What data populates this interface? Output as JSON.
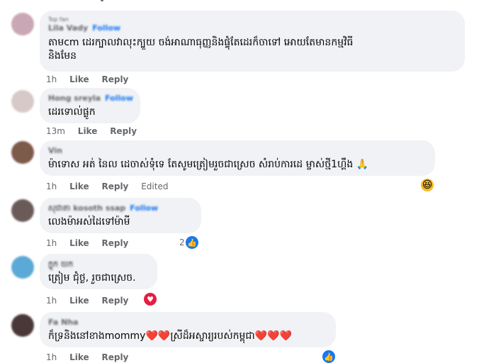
{
  "comments": [
    {
      "top_label": "Top fan",
      "author": "Lila Vady",
      "follow": "Follow",
      "text": "តាមcm ដេរក្បាលវាលុះក្បួយ ចង់អាណាធុញ្ញនិងផ្ទុំតែដេរក៏ចាទៅ អោយតែមានកម្មវិធី\nនិងមែន",
      "time": "1h",
      "like": "Like",
      "reply": "Reply",
      "avatar_color": "#c9a7b4"
    },
    {
      "author": "Hong sreyla",
      "follow": "Follow",
      "text": "ដេរទោល់ផ្លូក",
      "time": "13m",
      "like": "Like",
      "reply": "Reply",
      "avatar_color": "#d8c9c9"
    },
    {
      "author": "Vin",
      "text": "ម៉ាទោស អត់ នៃល ដេចាស់ទុំទេ តែសូមត្រៀមរួចជាស្រេច សំរាប់ការដេ ម្ចាស់ថ្មី1ហ្គឹង 🙏",
      "time": "1h",
      "like": "Like",
      "reply": "Reply",
      "edited": "Edited",
      "reaction": "😆",
      "avatar_color": "#7d5a4a"
    },
    {
      "author": "សុជាតា kosoth ssap",
      "follow": "Follow",
      "text": "លេងម៉ាអស់ដៃទៅម៉ាមី",
      "time": "1h",
      "like": "Like",
      "reply": "Reply",
      "reaction_count": "2",
      "reaction": "👍",
      "avatar_color": "#6b5b58"
    },
    {
      "author": "ក្លូក យក",
      "text": "ត្រៀម ជុំថ្ង, រួចជាស្រេច.",
      "time": "1h",
      "like": "Like",
      "reply": "Reply",
      "reaction": "♥",
      "avatar_color": "#5aa9d6"
    },
    {
      "author": "Fa Nha",
      "text": "ក៏ទ្រនិងនៅខាងmommy❤️❤️ស្រីដ៏អស្ចារ្យរបស់កម្ពុជា❤️❤️❤️",
      "time": "1h",
      "like": "Like",
      "reply": "Reply",
      "reaction": "👍",
      "avatar_color": "#4a3838"
    }
  ],
  "colors": {
    "bubble": "#f0f2f5",
    "link": "#1877f2",
    "meta": "#65676b",
    "like_blue": "#1877f2",
    "love_red": "#e41e3f",
    "haha_yellow": "#f7b928"
  }
}
